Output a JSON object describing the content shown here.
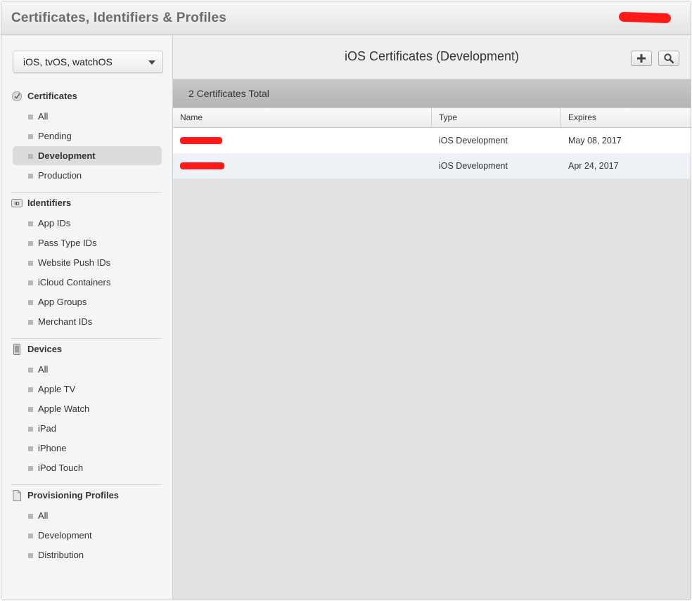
{
  "header": {
    "title": "Certificates, Identifiers & Profiles"
  },
  "sidebar": {
    "platform_select": "iOS, tvOS, watchOS",
    "sections": [
      {
        "title": "Certificates",
        "icon": "certificate-badge-icon",
        "items": [
          "All",
          "Pending",
          "Development",
          "Production"
        ],
        "active_item": "Development"
      },
      {
        "title": "Identifiers",
        "icon": "id-badge-icon",
        "items": [
          "App IDs",
          "Pass Type IDs",
          "Website Push IDs",
          "iCloud Containers",
          "App Groups",
          "Merchant IDs"
        ]
      },
      {
        "title": "Devices",
        "icon": "device-icon",
        "items": [
          "All",
          "Apple TV",
          "Apple Watch",
          "iPad",
          "iPhone",
          "iPod Touch"
        ]
      },
      {
        "title": "Provisioning Profiles",
        "icon": "document-icon",
        "items": [
          "All",
          "Development",
          "Distribution"
        ]
      }
    ]
  },
  "main": {
    "title": "iOS Certificates (Development)",
    "add_button_icon": "plus-icon",
    "search_button_icon": "search-icon",
    "summary": "2 Certificates Total",
    "columns": [
      "Name",
      "Type",
      "Expires"
    ],
    "rows": [
      {
        "type": "iOS Development",
        "expires": "May 08, 2017",
        "name_redacted": true
      },
      {
        "type": "iOS Development",
        "expires": "Apr 24, 2017",
        "name_redacted": true
      }
    ]
  },
  "colors": {
    "redaction": "#ff1a1a",
    "active_nav": "#dcdcdc",
    "alt_row": "#eef1f6"
  }
}
